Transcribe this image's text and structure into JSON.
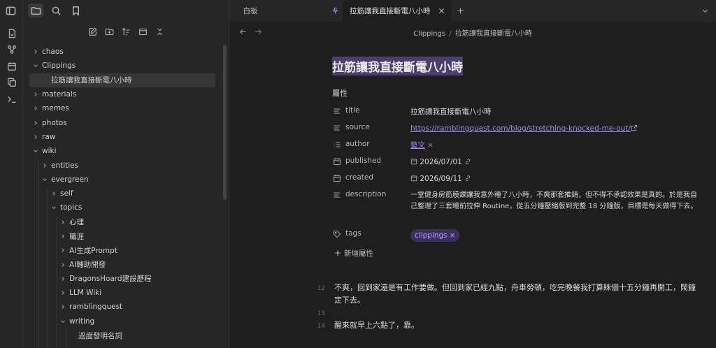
{
  "ribbon": {
    "icons": [
      "file-icon",
      "graph-icon",
      "calendar-icon",
      "copy-icon",
      "terminal-icon"
    ]
  },
  "sidebar": {
    "tree": [
      {
        "label": "chaos",
        "depth": 0,
        "expanded": false,
        "selected": false,
        "folder": true
      },
      {
        "label": "Clippings",
        "depth": 0,
        "expanded": true,
        "selected": false,
        "folder": true
      },
      {
        "label": "拉筋讓我直接斷電八小時",
        "depth": 1,
        "expanded": false,
        "selected": true,
        "folder": false
      },
      {
        "label": "materials",
        "depth": 0,
        "expanded": false,
        "selected": false,
        "folder": true
      },
      {
        "label": "memes",
        "depth": 0,
        "expanded": false,
        "selected": false,
        "folder": true
      },
      {
        "label": "photos",
        "depth": 0,
        "expanded": false,
        "selected": false,
        "folder": true
      },
      {
        "label": "raw",
        "depth": 0,
        "expanded": false,
        "selected": false,
        "folder": true
      },
      {
        "label": "wiki",
        "depth": 0,
        "expanded": true,
        "selected": false,
        "folder": true
      },
      {
        "label": "entities",
        "depth": 1,
        "expanded": false,
        "selected": false,
        "folder": true
      },
      {
        "label": "evergreen",
        "depth": 1,
        "expanded": true,
        "selected": false,
        "folder": true
      },
      {
        "label": "self",
        "depth": 2,
        "expanded": false,
        "selected": false,
        "folder": true
      },
      {
        "label": "topics",
        "depth": 2,
        "expanded": true,
        "selected": false,
        "folder": true
      },
      {
        "label": "心理",
        "depth": 3,
        "expanded": false,
        "selected": false,
        "folder": true
      },
      {
        "label": "職涯",
        "depth": 3,
        "expanded": false,
        "selected": false,
        "folder": true
      },
      {
        "label": "AI生成Prompt",
        "depth": 3,
        "expanded": false,
        "selected": false,
        "folder": true
      },
      {
        "label": "AI輔助開發",
        "depth": 3,
        "expanded": false,
        "selected": false,
        "folder": true
      },
      {
        "label": "DragonsHoard建設歷程",
        "depth": 3,
        "expanded": false,
        "selected": false,
        "folder": true
      },
      {
        "label": "LLM Wiki",
        "depth": 3,
        "expanded": false,
        "selected": false,
        "folder": true
      },
      {
        "label": "ramblingquest",
        "depth": 3,
        "expanded": false,
        "selected": false,
        "folder": true
      },
      {
        "label": "writing",
        "depth": 3,
        "expanded": true,
        "selected": false,
        "folder": true
      },
      {
        "label": "過度發明名詞",
        "depth": 4,
        "expanded": false,
        "selected": false,
        "folder": false
      }
    ]
  },
  "tabs": [
    {
      "label": "白板",
      "active": false
    },
    {
      "label": "拉筋讓我直接斷電八小時",
      "active": true
    }
  ],
  "breadcrumb": {
    "folder": "Clippings",
    "sep": "/",
    "page": "拉筋讓我直接斷電八小時"
  },
  "note": {
    "title": "拉筋讓我直接斷電八小時",
    "props_heading": "屬性",
    "properties": {
      "title": {
        "key": "title",
        "value": "拉筋讓我直接斷電八小時"
      },
      "source": {
        "key": "source",
        "value": "https://ramblingquest.com/blog/stretching-knocked-me-out/"
      },
      "author": {
        "key": "author",
        "value": "藝文"
      },
      "published": {
        "key": "published",
        "value": "2026/07/01"
      },
      "created": {
        "key": "created",
        "value": "2026/09/11"
      },
      "description": {
        "key": "description",
        "value": "一堂健身房筋膜課讓我意外睡了八小時，不爽那套推銷，但不得不承認效果是真的。於是我自己整理了三套睡前拉伸 Routine，從五分鐘壓縮版到完整 18 分鐘版，目標是每天做得下去。"
      },
      "tags": {
        "key": "tags",
        "value": "clippings"
      }
    },
    "add_property": "新增屬性",
    "lines": [
      {
        "no": "12",
        "text": "不爽，回到家還是有工作要做。但回到家已經九點，舟車勞頓，吃完晚餐我打算眯個十五分鐘再開工，鬧鐘定下去。"
      },
      {
        "no": "13",
        "text": ""
      },
      {
        "no": "14",
        "text": "醒來就早上六點了，靠。"
      }
    ]
  },
  "colors": {
    "accent": "#a688ef",
    "title_highlight": "#4c3f6e",
    "tag_bg": "#3b2f5b"
  }
}
